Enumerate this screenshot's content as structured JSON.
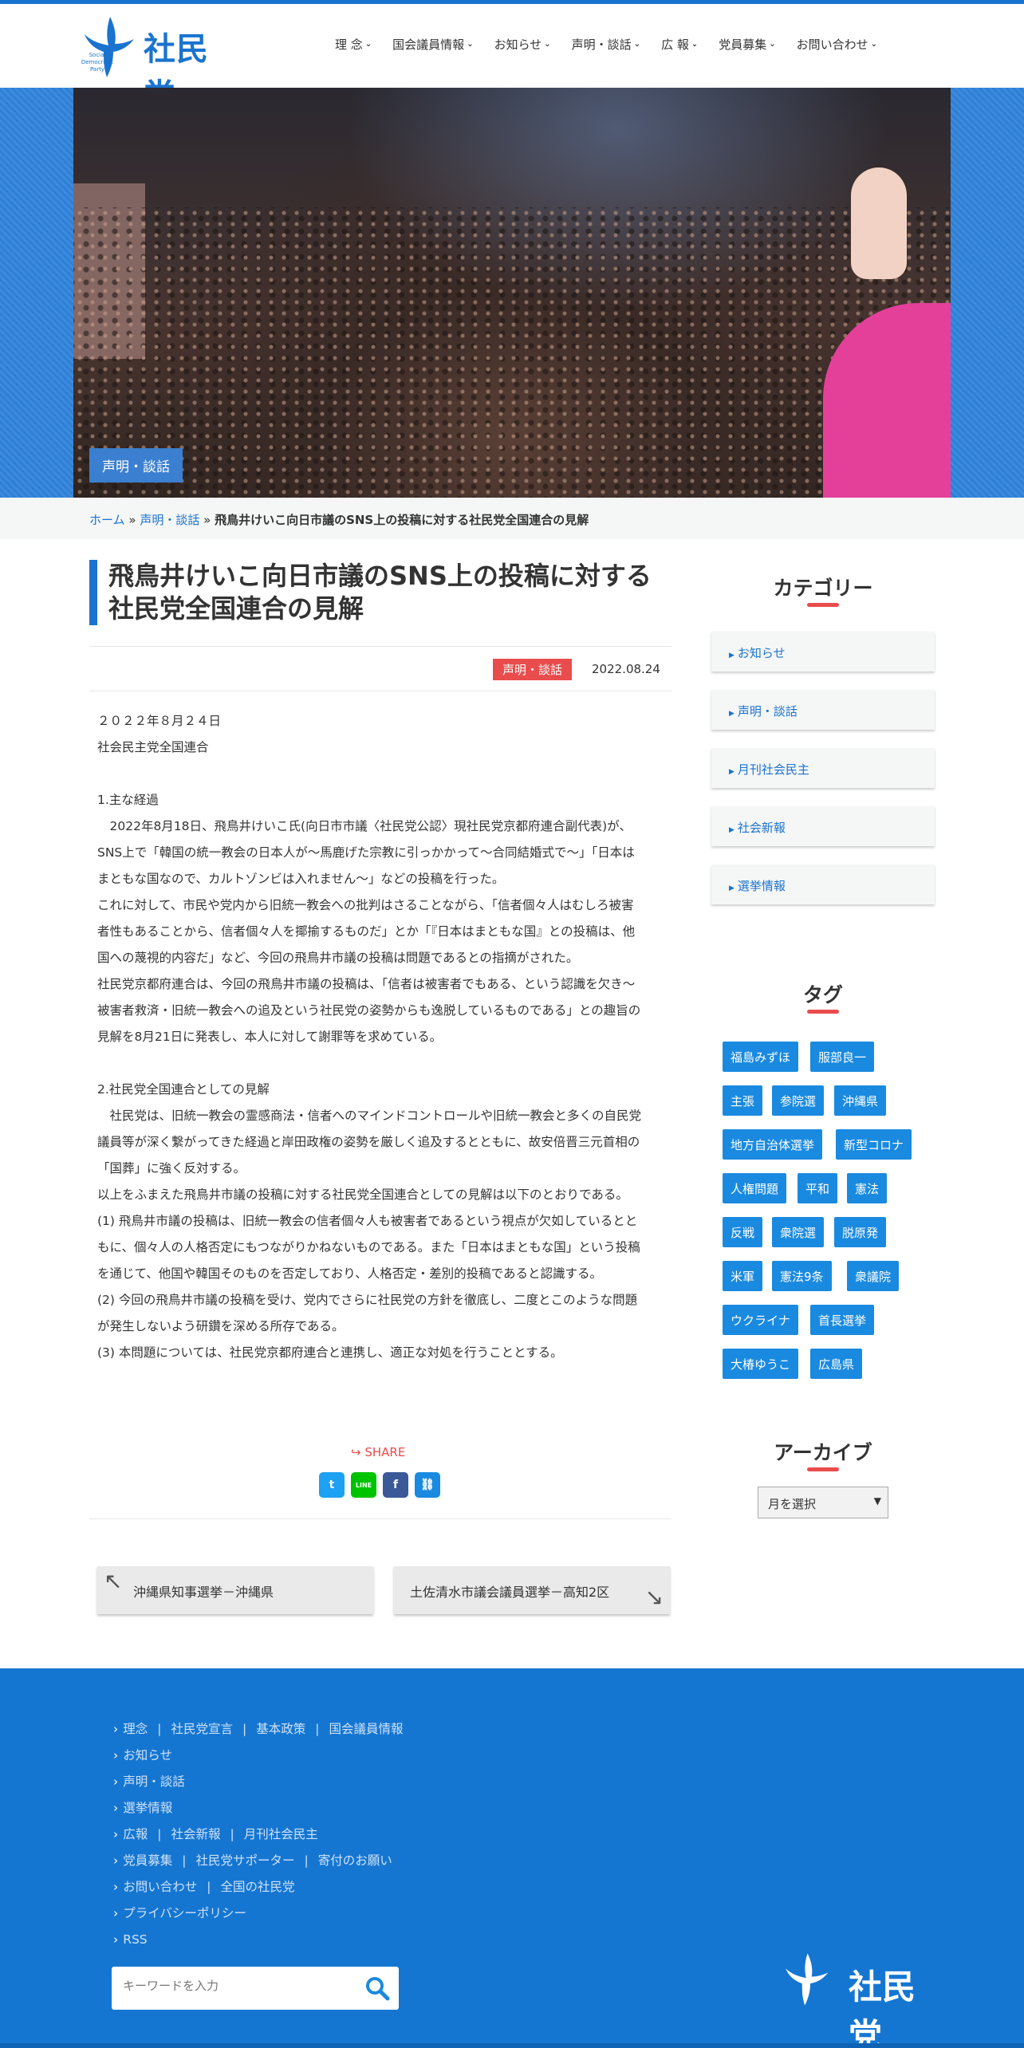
{
  "header": {
    "logo_text": "社民党",
    "logo_en": "Social Democratic Party",
    "nav": [
      "理 念",
      "国会議員情報",
      "お知らせ",
      "声明・談話",
      "広 報",
      "党員募集",
      "お問い合わせ"
    ]
  },
  "hero": {
    "category": "声明・談話"
  },
  "breadcrumb": {
    "home": "ホーム",
    "sep1": "»",
    "category": "声明・談話",
    "sep2": "»",
    "current": "飛鳥井けいこ向日市議のSNS上の投稿に対する社民党全国連合の見解"
  },
  "article": {
    "title_line1": "飛鳥井けいこ向日市議のSNS上の投稿に対する",
    "title_line2": "社民党全国連合の見解",
    "category": "声明・談話",
    "date": "2022.08.24",
    "body": [
      "２０２２年８月２４日",
      "社会民主党全国連合",
      "",
      "1.主な経過",
      "　2022年8月18日、飛鳥井けいこ氏(向日市市議〈社民党公認〉現社民党京都府連合副代表)が、",
      "SNS上で「韓国の統一教会の日本人が～馬鹿げた宗教に引っかかって～合同結婚式で～」「日本は",
      "まともな国なので、カルトゾンビは入れません～」などの投稿を行った。",
      "これに対して、市民や党内から旧統一教会への批判はさることながら、「信者個々人はむしろ被害",
      "者性もあることから、信者個々人を揶揄するものだ」とか「『日本はまともな国』との投稿は、他",
      "国への蔑視的内容だ」など、今回の飛鳥井市議の投稿は問題であるとの指摘がされた。",
      "社民党京都府連合は、今回の飛鳥井市議の投稿は、「信者は被害者でもある、という認識を欠き～",
      "被害者救済・旧統一教会への追及という社民党の姿勢からも逸脱しているものである」との趣旨の",
      "見解を8月21日に発表し、本人に対して謝罪等を求めている。",
      "",
      "2.社民党全国連合としての見解",
      "　社民党は、旧統一教会の霊感商法・信者へのマインドコントロールや旧統一教会と多くの自民党",
      "議員等が深く繋がってきた経過と岸田政権の姿勢を厳しく追及するとともに、故安倍晋三元首相の",
      "「国葬」に強く反対する。",
      "以上をふまえた飛鳥井市議の投稿に対する社民党全国連合としての見解は以下のとおりである。",
      "(1) 飛鳥井市議の投稿は、旧統一教会の信者個々人も被害者であるという視点が欠如しているとと",
      "もに、個々人の人格否定にもつながりかねないものである。また「日本はまともな国」という投稿",
      "を通じて、他国や韓国そのものを否定しており、人格否定・差別的投稿であると認識する。",
      "(2) 今回の飛鳥井市議の投稿を受け、党内でさらに社民党の方針を徹底し、二度とこのような問題",
      "が発生しないよう研鑽を深める所存である。",
      "(3) 本問題については、社民党京都府連合と連携し、適正な対処を行うこととする。"
    ]
  },
  "share": {
    "label": "SHARE",
    "icons": [
      {
        "name": "twitter-icon",
        "glyph": "t",
        "color": "#1da1f2"
      },
      {
        "name": "line-icon",
        "glyph": "LINE",
        "color": "#00c300"
      },
      {
        "name": "facebook-icon",
        "glyph": "f",
        "color": "#3b5998"
      },
      {
        "name": "copy-link-icon",
        "glyph": "⛓",
        "color": "#1a8ae0"
      }
    ]
  },
  "post_nav": {
    "prev": "沖縄県知事選挙－沖縄県",
    "next": "土佐清水市議会議員選挙－高知2区"
  },
  "sidebar": {
    "category_title": "カテゴリー",
    "categories": [
      "お知らせ",
      "声明・談話",
      "月刊社会民主",
      "社会新報",
      "選挙情報"
    ],
    "tag_title": "タグ",
    "tags": [
      [
        "福島みずほ",
        "服部良一"
      ],
      [
        "主張",
        "参院選",
        "沖縄県"
      ],
      [
        "地方自治体選挙",
        "新型コロナ"
      ],
      [
        "人権問題",
        "平和",
        "憲法"
      ],
      [
        "反戦",
        "衆院選",
        "脱原発"
      ],
      [
        "米軍",
        "憲法9条",
        "衆議院"
      ],
      [
        "ウクライナ",
        "首長選挙"
      ],
      [
        "大椿ゆうこ",
        "広島県"
      ]
    ],
    "archive_title": "アーカイブ",
    "archive_select": "月を選択"
  },
  "footer": {
    "rows": [
      [
        "理念",
        "社民党宣言",
        "基本政策",
        "国会議員情報"
      ],
      [
        "お知らせ"
      ],
      [
        "声明・談話"
      ],
      [
        "選挙情報"
      ],
      [
        "広報",
        "社会新報",
        "月刊社会民主"
      ],
      [
        "党員募集",
        "社民党サポーター",
        "寄付のお願い"
      ],
      [
        "お問い合わせ",
        "全国の社民党"
      ],
      [
        "プライバシーポリシー"
      ],
      [
        "RSS"
      ]
    ],
    "search_placeholder": "キーワードを入力",
    "logo_text": "社民党"
  },
  "colors": {
    "brand": "#1a73cf",
    "accent": "#e94c4c",
    "tag": "#1a8ae0",
    "footer": "#1576d2"
  }
}
